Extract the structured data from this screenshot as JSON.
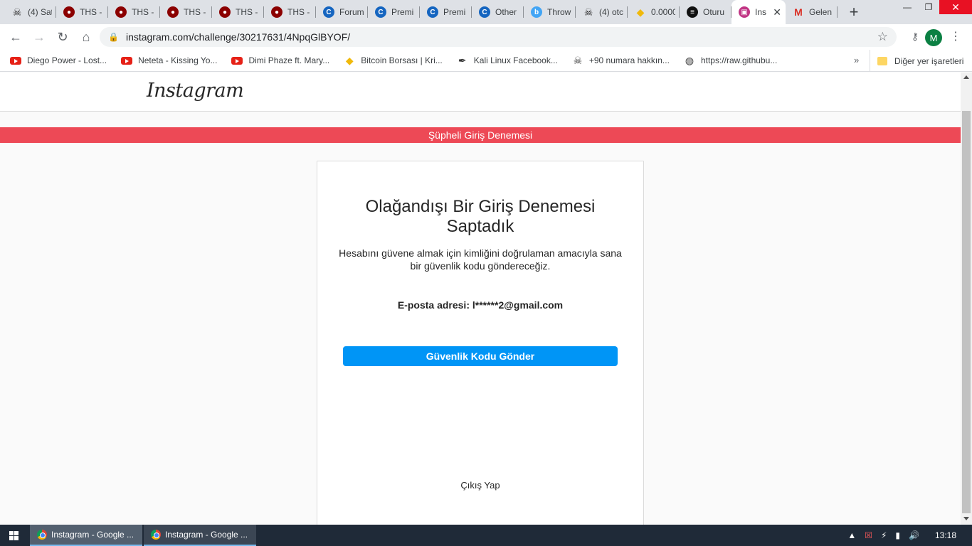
{
  "browser": {
    "tabs": [
      {
        "title": "(4) Sat",
        "icon": "skull-icon",
        "color": "#222222"
      },
      {
        "title": "THS -",
        "icon": "ths-icon",
        "color": "#8b0000"
      },
      {
        "title": "THS -",
        "icon": "ths-icon",
        "color": "#8b0000"
      },
      {
        "title": "THS -",
        "icon": "ths-icon",
        "color": "#8b0000"
      },
      {
        "title": "THS -",
        "icon": "ths-icon",
        "color": "#8b0000"
      },
      {
        "title": "THS -",
        "icon": "ths-icon",
        "color": "#8b0000"
      },
      {
        "title": "Forum",
        "icon": "c-icon",
        "color": "#1565c0"
      },
      {
        "title": "Premi",
        "icon": "c-icon",
        "color": "#1565c0"
      },
      {
        "title": "Premi",
        "icon": "c-icon",
        "color": "#1565c0"
      },
      {
        "title": "Other",
        "icon": "c-icon",
        "color": "#1565c0"
      },
      {
        "title": "Throw",
        "icon": "b-icon",
        "color": "#42a5f5"
      },
      {
        "title": "(4) otc",
        "icon": "skull-icon",
        "color": "#222222"
      },
      {
        "title": "0.0000",
        "icon": "binance-icon",
        "color": "#f0b90b"
      },
      {
        "title": "Oturu",
        "icon": "spotify-icon",
        "color": "#111111"
      },
      {
        "title": "Ins",
        "icon": "instagram-icon",
        "color": "#c13584",
        "active": true
      },
      {
        "title": "Gelen",
        "icon": "gmail-icon",
        "color": "#d93025"
      }
    ],
    "new_tab": "+",
    "address": "instagram.com/challenge/30217631/4NpqGlBYOF/",
    "profile_initial": "M",
    "bookmarks": [
      {
        "label": "Diego Power - Lost...",
        "icon": "youtube-icon"
      },
      {
        "label": "Neteta - Kissing Yo...",
        "icon": "youtube-icon"
      },
      {
        "label": "Dimi Phaze ft. Mary...",
        "icon": "youtube-icon"
      },
      {
        "label": "Bitcoin Borsası | Kri...",
        "icon": "binance-icon"
      },
      {
        "label": "Kali Linux Facebook...",
        "icon": "kali-icon"
      },
      {
        "label": "+90 numara hakkın...",
        "icon": "skull-icon"
      },
      {
        "label": "https://raw.githubu...",
        "icon": "globe-icon"
      }
    ],
    "bookmarks_more": "»",
    "other_bookmarks": "Diğer yer işaretleri"
  },
  "page": {
    "logo": "Instagram",
    "alert": "Şüpheli Giriş Denemesi",
    "title": "Olağandışı Bir Giriş Denemesi Saptadık",
    "description": "Hesabını güvene almak için kimliğini doğrulaman amacıyla sana bir güvenlik kodu göndereceğiz.",
    "email_line": "E-posta adresi: l******2@gmail.com",
    "send_button": "Güvenlik Kodu Gönder",
    "logout": "Çıkış Yap"
  },
  "taskbar": {
    "items": [
      {
        "label": "Instagram - Google ...",
        "active": true
      },
      {
        "label": "Instagram - Google ...",
        "active": false
      }
    ],
    "clock": "13:18"
  }
}
